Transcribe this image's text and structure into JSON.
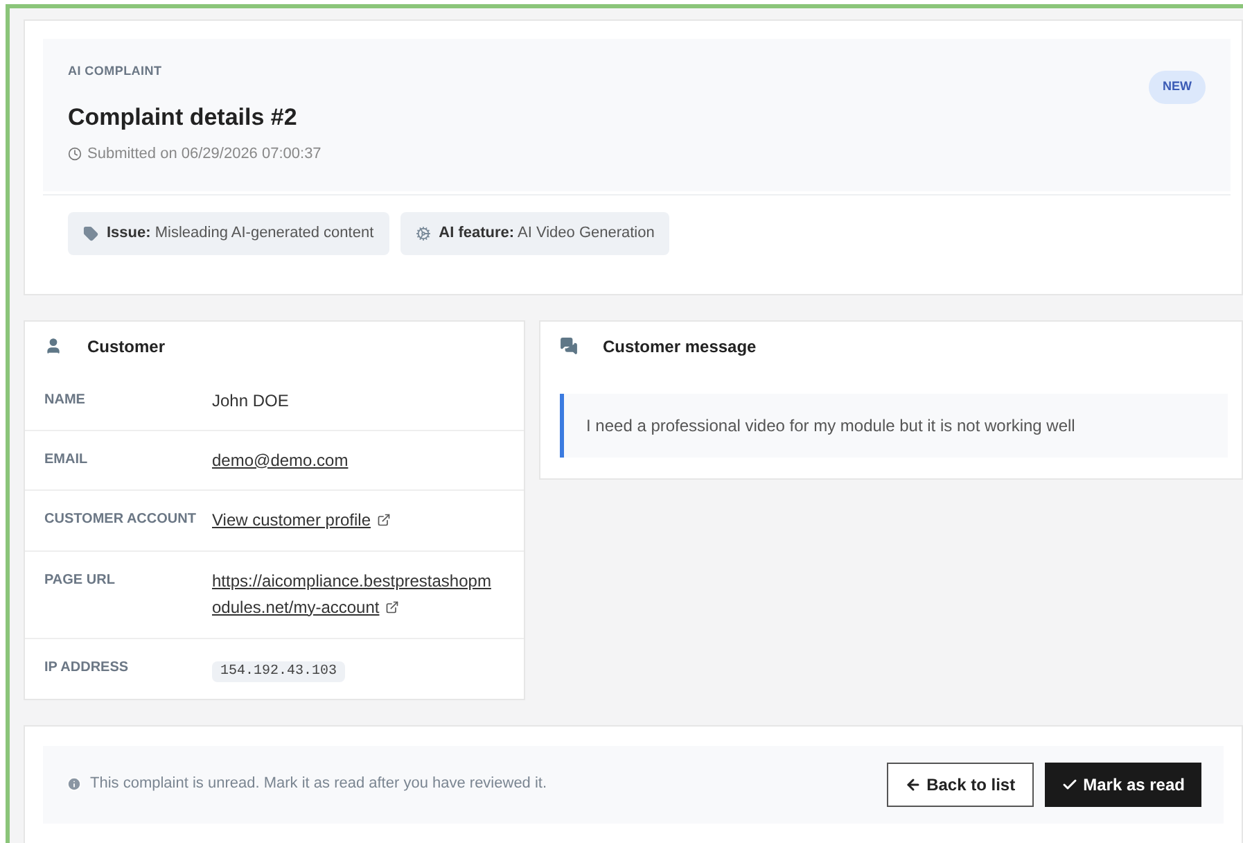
{
  "header": {
    "eyebrow": "AI COMPLAINT",
    "title": "Complaint details #2",
    "submitted": "Submitted on 06/29/2026 07:00:37",
    "badge": "NEW",
    "tags": [
      {
        "kind": "issue",
        "label": "Issue:",
        "value": "Misleading AI-generated content"
      },
      {
        "kind": "feature",
        "label": "AI feature:",
        "value": "AI Video Generation"
      }
    ]
  },
  "customer": {
    "title": "Customer",
    "fields": [
      {
        "kind": "text",
        "label": "NAME",
        "value": "John DOE"
      },
      {
        "kind": "link",
        "label": "EMAIL",
        "value": "demo@demo.com"
      },
      {
        "kind": "external",
        "label": "CUSTOMER ACCOUNT",
        "value": "View customer profile"
      },
      {
        "kind": "external",
        "label": "PAGE URL",
        "value": "https://aicompliance.bestprestashopmodules.net/my-account"
      },
      {
        "kind": "code",
        "label": "IP ADDRESS",
        "value": "154.192.43.103"
      }
    ]
  },
  "message": {
    "title": "Customer message",
    "text": "I need a professional video for my module but it is not working well"
  },
  "footer": {
    "notice": "This complaint is unread. Mark it as read after you have reviewed it.",
    "buttons": [
      {
        "kind": "back",
        "label": "Back to list"
      },
      {
        "kind": "primary",
        "label": "Mark as read"
      }
    ]
  }
}
